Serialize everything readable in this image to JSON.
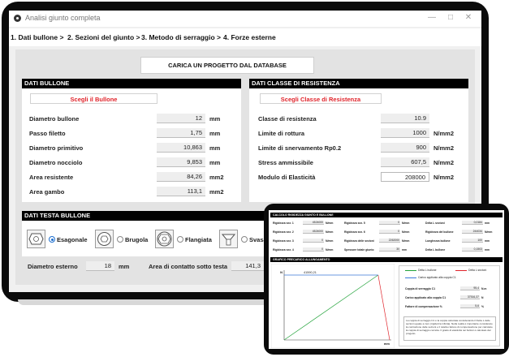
{
  "window": {
    "title": "Analisi giunto completa",
    "min": "—",
    "max": "□",
    "close": "✕"
  },
  "steps": [
    "1. Dati bullone >",
    "2. Sezioni del giunto >",
    "3. Metodo di serraggio >",
    "4. Forze esterne"
  ],
  "load_button": "CARICA UN PROGETTO DAL DATABASE",
  "bolt": {
    "header": "DATI BULLONE",
    "choose": "Scegli il Bullone",
    "rows": [
      {
        "label": "Diametro bullone",
        "value": "12",
        "unit": "mm"
      },
      {
        "label": "Passo filetto",
        "value": "1,75",
        "unit": "mm"
      },
      {
        "label": "Diametro primitivo",
        "value": "10,863",
        "unit": "mm"
      },
      {
        "label": "Diametro nocciolo",
        "value": "9,853",
        "unit": "mm"
      },
      {
        "label": "Area resistente",
        "value": "84,26",
        "unit": "mm2"
      },
      {
        "label": "Area gambo",
        "value": "113,1",
        "unit": "mm2"
      }
    ]
  },
  "class": {
    "header": "DATI CLASSE DI RESISTENZA",
    "choose": "Scegli Classe di Resistenza",
    "rows": [
      {
        "label": "Classe di resistenza",
        "value": "10.9",
        "unit": ""
      },
      {
        "label": "Limite di rottura",
        "value": "1000",
        "unit": "N/mm2"
      },
      {
        "label": "Limite di snervamento Rp0.2",
        "value": "900",
        "unit": "N/mm2"
      },
      {
        "label": "Stress ammissibile",
        "value": "607,5",
        "unit": "N/mm2"
      },
      {
        "label": "Modulo di Elasticità",
        "value": "208000",
        "unit": "N/mm2"
      }
    ]
  },
  "head": {
    "header": "DATI TESTA BULLONE",
    "options": [
      "Esagonale",
      "Brugola",
      "Flangiata",
      "Svasa"
    ],
    "selected": "Esagonale",
    "outer_label": "Diametro esterno",
    "outer_value": "18",
    "outer_unit": "mm",
    "contact_label": "Area di contatto sotto testa",
    "contact_value": "141,3"
  },
  "tablet": {
    "stiffness_header": "CALCOLO RIGIDEZZA GIUNTO E BULLONE",
    "col1": [
      {
        "label": "Rigidezza sez. 1",
        "value": "4524000",
        "unit": "N/mm"
      },
      {
        "label": "Rigidezza sez. 2",
        "value": "4524000",
        "unit": "N/mm"
      },
      {
        "label": "Rigidezza sez. 3",
        "value": "0",
        "unit": "N/mm"
      },
      {
        "label": "Rigidezza sez. 4",
        "value": "0",
        "unit": "N/mm"
      }
    ],
    "col2": [
      {
        "label": "Rigidezza sez. 5",
        "value": "0",
        "unit": "N/mm"
      },
      {
        "label": "Rigidezza sez. 6",
        "value": "0",
        "unit": "N/mm"
      },
      {
        "label": "Rigidezza delle sezioni",
        "value": "2262000",
        "unit": "N/mm"
      },
      {
        "label": "Spessore totale giunto",
        "value": "30",
        "unit": "mm"
      }
    ],
    "col3": [
      {
        "label": "Delta L sezioni",
        "value": "0,0184",
        "unit": "mm"
      },
      {
        "label": "Rigidezza del bullone",
        "value": "244034",
        "unit": "N/mm"
      },
      {
        "label": "Lunghezza bullone",
        "value": "100",
        "unit": "mm"
      },
      {
        "label": "Delta L bullone",
        "value": "0,1503",
        "unit": "mm"
      }
    ],
    "graph_header": "GRAFICO PRECARICO ALLUNGAMENTO",
    "graph_y_label": "N",
    "graph_x_label": "mm",
    "graph_peak": "41590,21",
    "legend": [
      "Delta L bullone",
      "Delta L sezioni",
      "Carico applicato alla coppia C1"
    ],
    "results": [
      {
        "label": "Coppia di serraggio C1",
        "value": "95,4",
        "unit": "N.m"
      },
      {
        "label": "Carico applicato alla coppia C1",
        "value": "37516,37",
        "unit": "N"
      },
      {
        "label": "Fattore di compensazione %",
        "value": "5,6",
        "unit": "%"
      }
    ],
    "note": "La coppia di serraggio C1 è la coppia calcolata considerando il Delta L delle sezioni uguale a zero (rigidezza infinita). Nella realtà è importante considerare la contrazione delle sezioni e il relativo fattore di compensazione per calcolare la coppia di serraggio corretta. Il grado di elasticità nei bulloni è calcolato dal progetto.",
    "colors": {
      "green": "#22a33a",
      "red": "#e0242b",
      "blue": "#3a78d8"
    }
  },
  "chart_data": {
    "type": "line",
    "title": "",
    "xlabel": "mm",
    "ylabel": "N",
    "annotations": [
      "41590,21"
    ],
    "series": [
      {
        "name": "Delta L bullone",
        "x": [
          0,
          0.1503
        ],
        "y": [
          0,
          41590.21
        ]
      },
      {
        "name": "Delta L sezioni",
        "x": [
          0.1503,
          0.1687
        ],
        "y": [
          41590.21,
          0
        ]
      },
      {
        "name": "Carico applicato alla coppia C1",
        "x": [
          0,
          0.1503
        ],
        "y": [
          41590.21,
          41590.21
        ]
      }
    ]
  }
}
